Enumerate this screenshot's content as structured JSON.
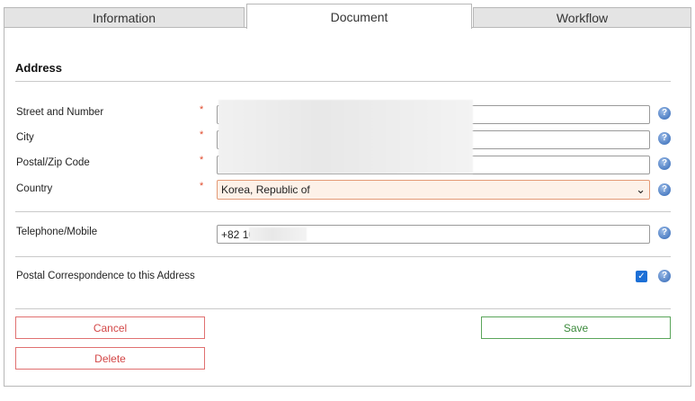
{
  "tabs": {
    "information": "Information",
    "document": "Document",
    "workflow": "Workflow"
  },
  "address": {
    "title": "Address",
    "street_label": "Street and Number",
    "city_label": "City",
    "postal_label": "Postal/Zip Code",
    "country_label": "Country",
    "country_value": "Korea, Republic of",
    "required_marker": "*"
  },
  "contact": {
    "phone_label": "Telephone/Mobile",
    "phone_value": "+82 10"
  },
  "postal": {
    "label": "Postal Correspondence to this Address",
    "checked": true
  },
  "help_glyph": "?",
  "actions": {
    "cancel": "Cancel",
    "delete": "Delete",
    "save": "Save"
  },
  "colors": {
    "required": "#e0492a",
    "help": "#4f7fc4",
    "danger": "#d34747",
    "success": "#3b8a3b",
    "checkbox": "#1c6fd6"
  }
}
